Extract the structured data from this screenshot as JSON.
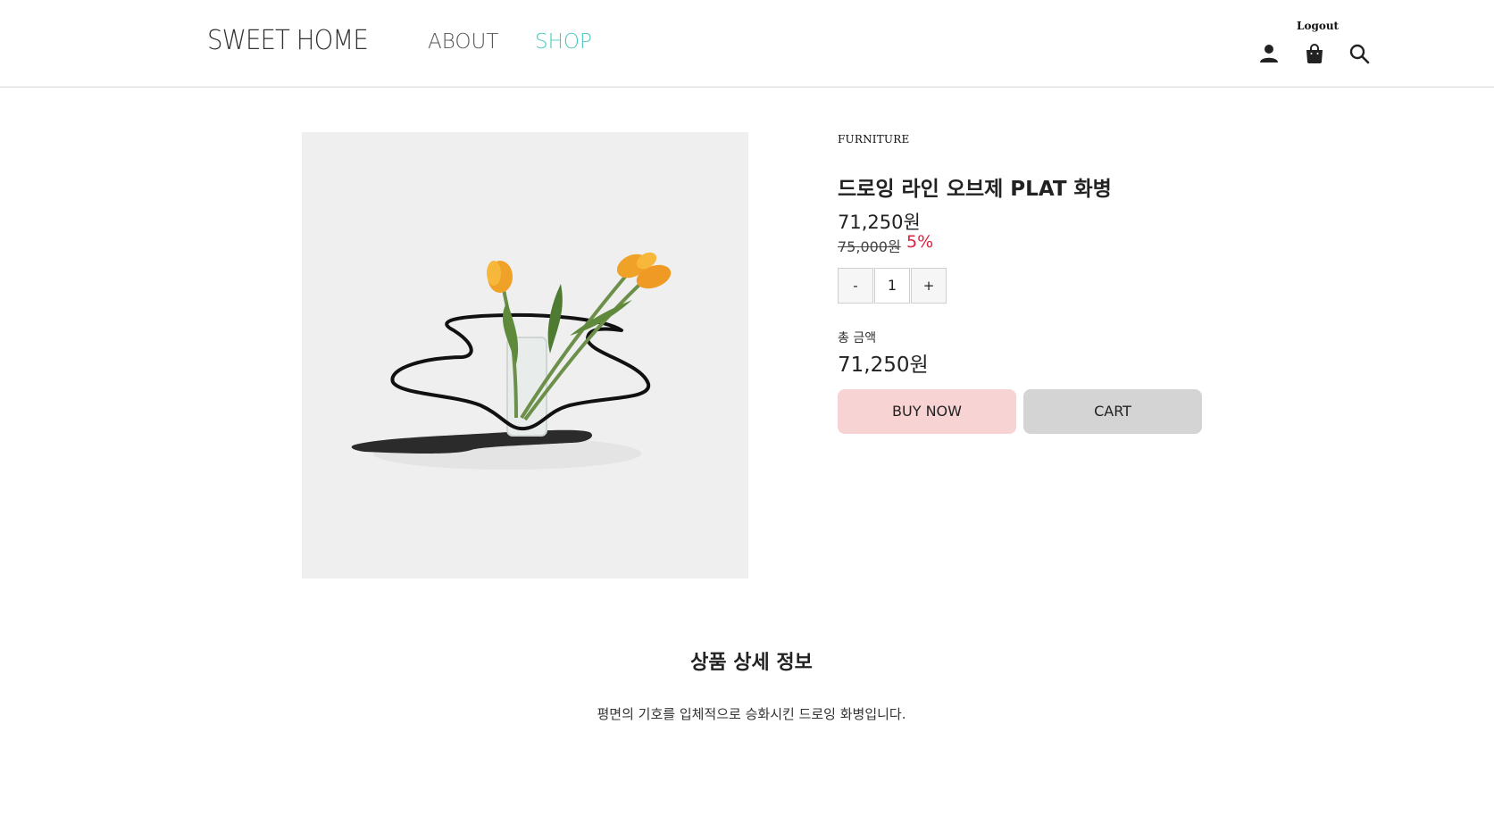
{
  "header": {
    "logo": "SWEET HOME",
    "nav": [
      {
        "label": "ABOUT",
        "color": "#555555"
      },
      {
        "label": "SHOP",
        "color": "#4cc9c0"
      }
    ],
    "logout_label": "Logout",
    "icons": [
      "user-icon",
      "shopping-bag-icon",
      "search-icon"
    ]
  },
  "product": {
    "image": "tulip-vase-image",
    "category": "FURNITURE",
    "title": "드로잉 라인 오브제 PLAT 화병",
    "price": "71,250원",
    "original_price": "75,000원",
    "discount": "5%",
    "quantity": {
      "minus": "-",
      "value": "1",
      "plus": "+"
    },
    "total_label": "총 금액",
    "total_value": "71,250원",
    "buy_now_label": "BUY NOW",
    "cart_label": "CART"
  },
  "detail": {
    "title": "상품 상세 정보",
    "description": "평면의 기호를 입체적으로 승화시킨 드로잉 화병입니다."
  },
  "colors": {
    "accent": "#4cc9c0",
    "discount": "#e0203f",
    "buy_button": "#f7d3d3",
    "cart_button": "#d4d4d4"
  }
}
